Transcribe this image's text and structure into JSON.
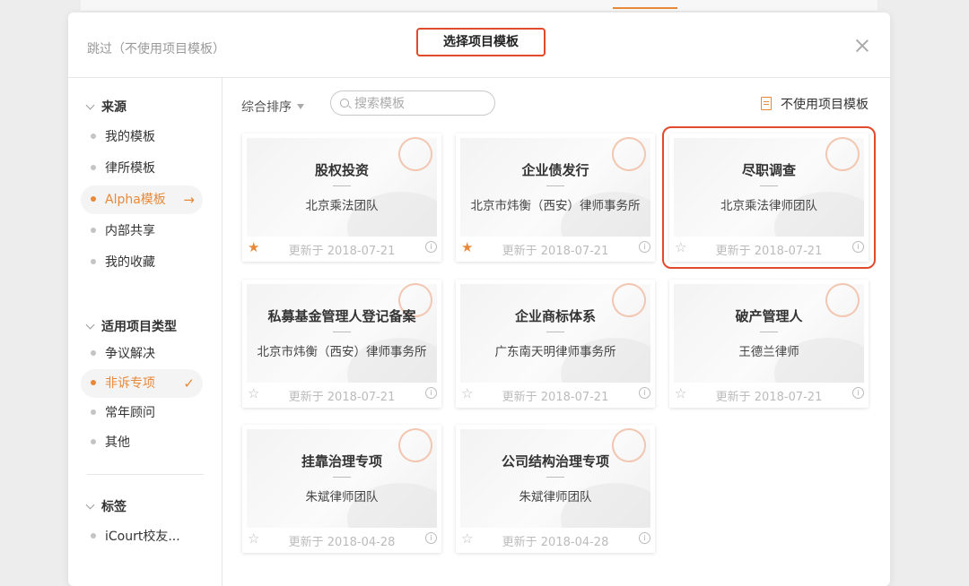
{
  "header": {
    "skip_label": "跳过（不使用项目模板）",
    "title": "选择项目模板"
  },
  "sidebar": {
    "sections": [
      {
        "heading": "来源",
        "items": [
          {
            "label": "我的模板",
            "active": false
          },
          {
            "label": "律所模板",
            "active": false
          },
          {
            "label": "Alpha模板",
            "active": true,
            "tail": "→"
          },
          {
            "label": "内部共享",
            "active": false
          },
          {
            "label": "我的收藏",
            "active": false
          }
        ]
      },
      {
        "heading": "适用项目类型",
        "items": [
          {
            "label": "争议解决",
            "active": false
          },
          {
            "label": "非诉专项",
            "active": true,
            "tail": "✓"
          },
          {
            "label": "常年顾问",
            "active": false
          },
          {
            "label": "其他",
            "active": false
          }
        ]
      },
      {
        "heading": "标签",
        "items": [
          {
            "label": "iCourt校友...",
            "active": false
          }
        ]
      }
    ]
  },
  "toolbar": {
    "sort_label": "综合排序",
    "search_placeholder": "搜索模板",
    "no_template_label": "不使用项目模板"
  },
  "cards": [
    {
      "title": "股权投资",
      "author": "北京乘法团队",
      "updated": "更新于 2018-07-21",
      "starred": true,
      "highlight": false
    },
    {
      "title": "企业债发行",
      "author": "北京市炜衡（西安）律师事务所",
      "updated": "更新于 2018-07-21",
      "starred": true,
      "highlight": false
    },
    {
      "title": "尽职调查",
      "author": "北京乘法律师团队",
      "updated": "更新于 2018-07-21",
      "starred": false,
      "highlight": true
    },
    {
      "title": "私募基金管理人登记备案",
      "author": "北京市炜衡（西安）律师事务所",
      "updated": "更新于 2018-07-21",
      "starred": false,
      "highlight": false
    },
    {
      "title": "企业商标体系",
      "author": "广东南天明律师事务所",
      "updated": "更新于 2018-07-21",
      "starred": false,
      "highlight": false
    },
    {
      "title": "破产管理人",
      "author": "王德兰律师",
      "updated": "更新于 2018-07-21",
      "starred": false,
      "highlight": false
    },
    {
      "title": "挂靠治理专项",
      "author": "朱斌律师团队",
      "updated": "更新于 2018-04-28",
      "starred": false,
      "highlight": false
    },
    {
      "title": "公司结构治理专项",
      "author": "朱斌律师团队",
      "updated": "更新于 2018-04-28",
      "starred": false,
      "highlight": false
    }
  ],
  "colors": {
    "accent": "#e8893a",
    "highlight_border": "#e14b2c"
  }
}
